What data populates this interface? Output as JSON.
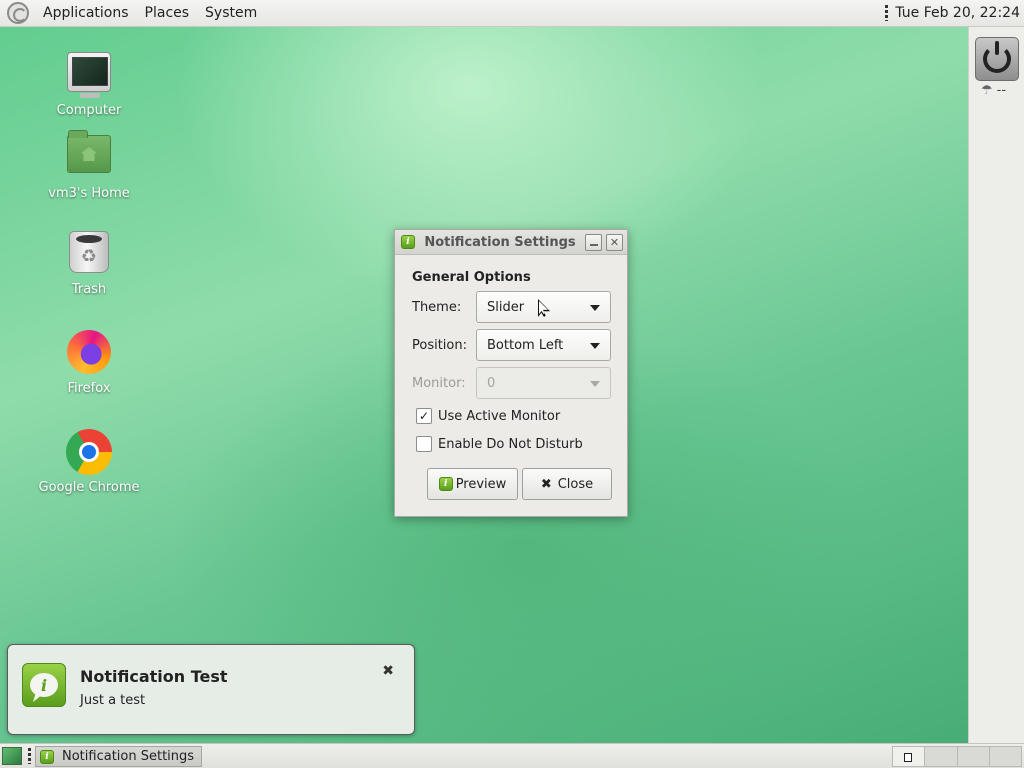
{
  "top_panel": {
    "menus": [
      "Applications",
      "Places",
      "System"
    ],
    "clock": "Tue Feb 20, 22:24"
  },
  "desktop_icons": [
    {
      "label": "Computer",
      "icon": "computer-icon"
    },
    {
      "label": "vm3's Home",
      "icon": "home-folder-icon"
    },
    {
      "label": "Trash",
      "icon": "trash-icon"
    },
    {
      "label": "Firefox",
      "icon": "firefox-icon"
    },
    {
      "label": "Google Chrome",
      "icon": "chrome-icon"
    }
  ],
  "side_panel": {
    "network_status": "--"
  },
  "dialog": {
    "title": "Notification Settings",
    "section_title": "General Options",
    "theme": {
      "label": "Theme:",
      "value": "Slider"
    },
    "position": {
      "label": "Position:",
      "value": "Bottom Left"
    },
    "monitor": {
      "label": "Monitor:",
      "value": "0",
      "disabled": true
    },
    "use_active_monitor": {
      "label": "Use Active Monitor",
      "checked": true,
      "mark": "✓"
    },
    "do_not_disturb": {
      "label": "Enable Do Not Disturb",
      "checked": false
    },
    "preview_label": "Preview",
    "close_label": "Close",
    "close_glyph": "✖"
  },
  "notification": {
    "title": "Notification Test",
    "body": "Just a test",
    "close_glyph": "✖",
    "icon_glyph": "i"
  },
  "bottom_panel": {
    "task_label": "Notification Settings",
    "workspaces": 4,
    "active_workspace": 1
  },
  "colors": {
    "accent_green": "#5a9e1d",
    "desktop_green": "#62cd8f"
  }
}
